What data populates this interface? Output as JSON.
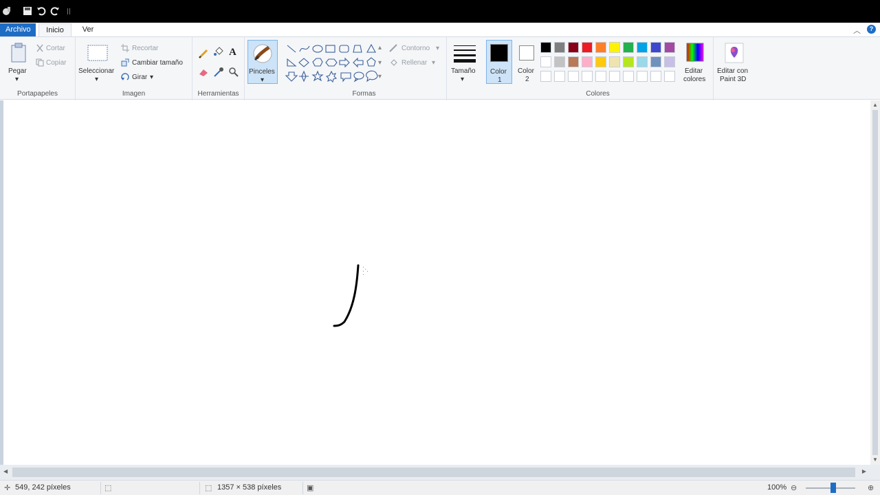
{
  "tabs": {
    "archivo": "Archivo",
    "inicio": "Inicio",
    "ver": "Ver"
  },
  "clipboard": {
    "paste": "Pegar",
    "cut": "Cortar",
    "copy": "Copiar",
    "group": "Portapapeles"
  },
  "image": {
    "select": "Seleccionar",
    "crop": "Recortar",
    "resize": "Cambiar tamaño",
    "rotate": "Girar",
    "group": "Imagen"
  },
  "tools": {
    "group": "Herramientas"
  },
  "brushes": {
    "label": "Pinceles"
  },
  "shapes": {
    "outline": "Contorno",
    "fill": "Rellenar",
    "group": "Formas"
  },
  "size": {
    "label": "Tamaño"
  },
  "colors": {
    "color1": "Color",
    "color1_num": "1",
    "color2": "Color",
    "color2_num": "2",
    "edit1": "Editar",
    "edit2": "colores",
    "group": "Colores",
    "row1": [
      "#000000",
      "#7f7f7f",
      "#880015",
      "#ed1c24",
      "#ff7f27",
      "#fff200",
      "#22b14c",
      "#00a2e8",
      "#3f48cc",
      "#a349a4"
    ],
    "row2": [
      "#ffffff",
      "#c3c3c3",
      "#b97a57",
      "#ffaec9",
      "#ffc90e",
      "#efe4b0",
      "#b5e61d",
      "#99d9ea",
      "#7092be",
      "#c8bfe7"
    ]
  },
  "paint3d": {
    "line1": "Editar con",
    "line2": "Paint 3D"
  },
  "status": {
    "cursor": "549, 242 píxeles",
    "canvas_size": "1357 × 538 píxeles",
    "zoom": "100%"
  }
}
